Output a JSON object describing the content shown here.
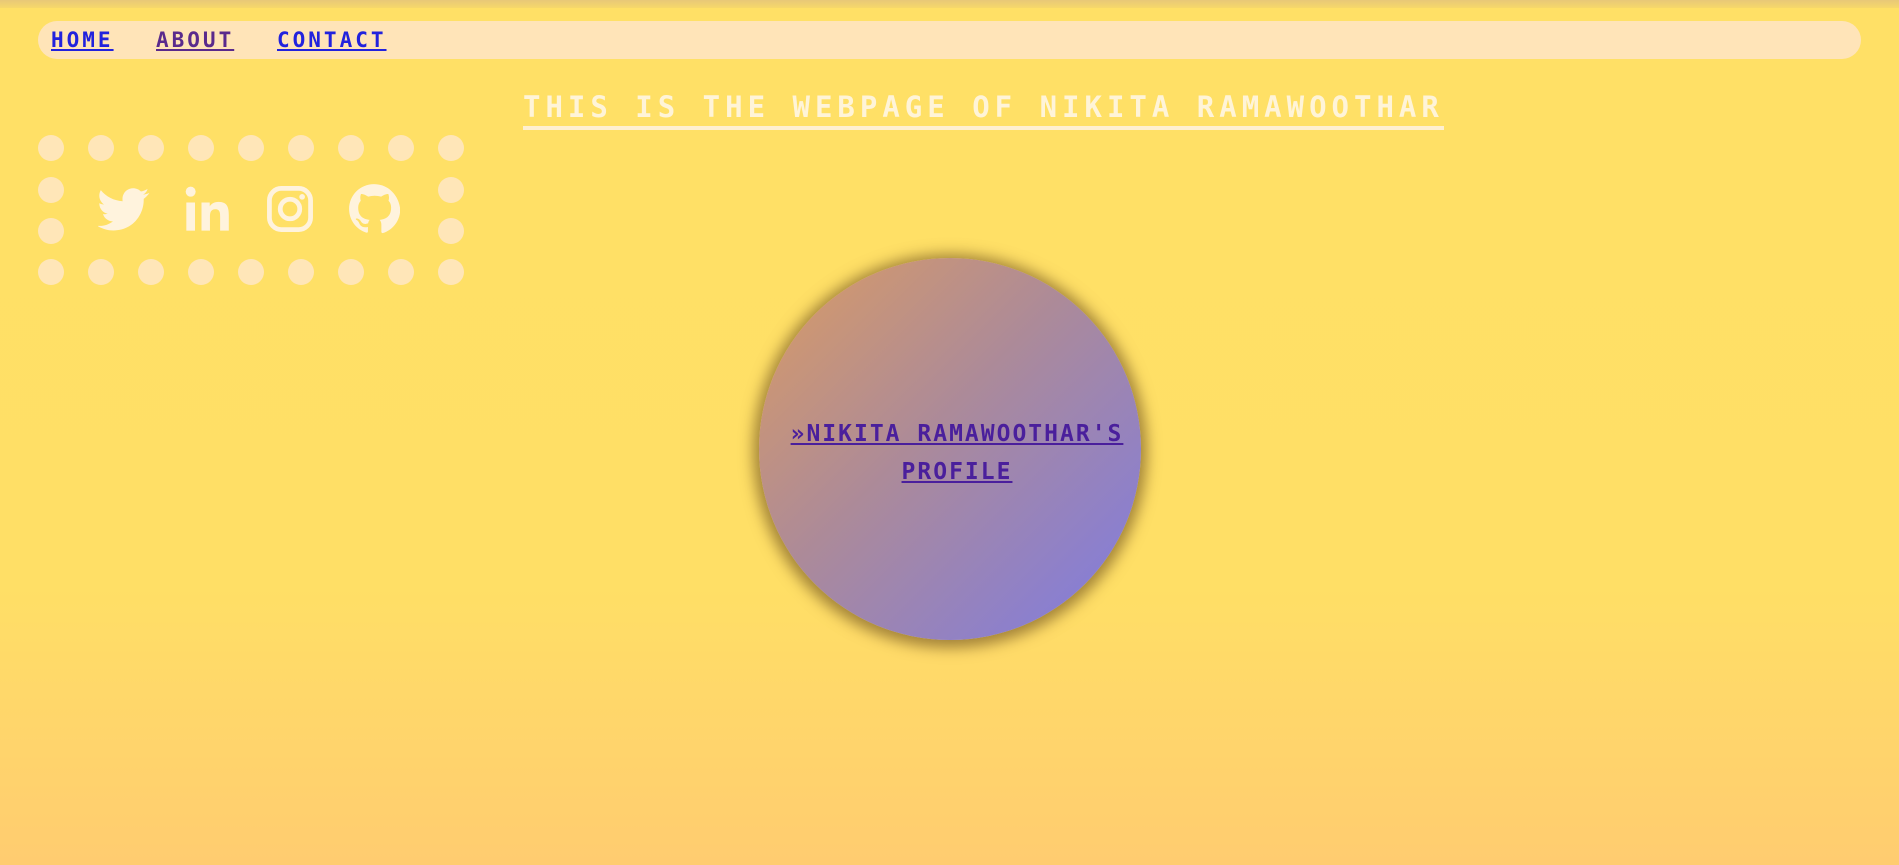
{
  "nav": {
    "home_label": "HOME",
    "about_label": "ABOUT",
    "contact_label": "CONTACT"
  },
  "page_title": "THIS IS THE WEBPAGE OF NIKITA RAMAWOOTHAR",
  "social": {
    "icons": [
      "twitter-icon",
      "linkedin-icon",
      "instagram-icon",
      "github-icon"
    ]
  },
  "profile": {
    "link_text": "»NIKITA RAMAWOOTHAR'S PROFILE"
  },
  "colors": {
    "background": "#ffe066",
    "nav_bar": "#ffe4b8",
    "link_blue": "#2222dd",
    "link_visited": "#5a2a8c",
    "title_text": "#fff4d8",
    "circle_start": "#db9c63",
    "circle_end": "#8a7fd0"
  }
}
